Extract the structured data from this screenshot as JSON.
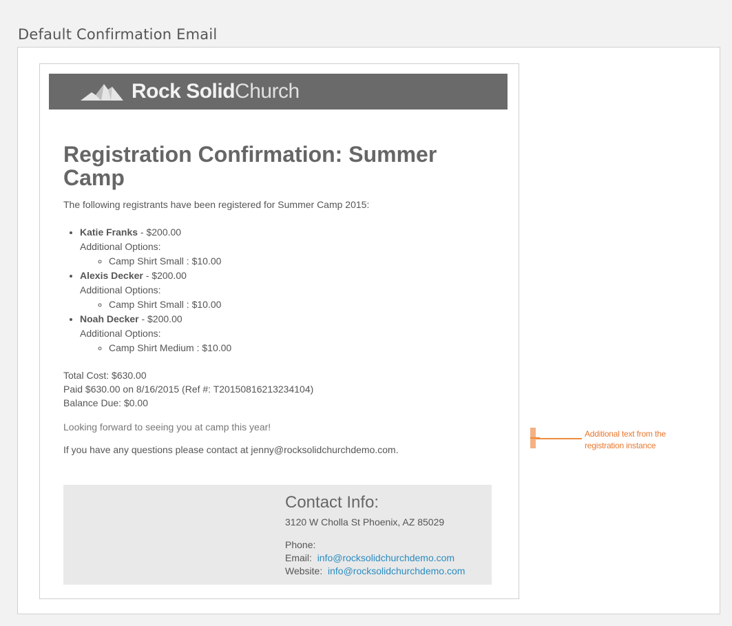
{
  "caption": "Default Confirmation Email",
  "brand": {
    "name_bold": "Rock Solid",
    "name_light": "Church",
    "logo_icon": "mountain-logo-icon"
  },
  "email": {
    "title": "Registration Confirmation: Summer Camp",
    "intro": "The following registrants have been registered for Summer Camp 2015:",
    "registrants": [
      {
        "name": "Katie Franks",
        "price": " - $200.00",
        "options_label": "Additional Options:",
        "option": "Camp Shirt Small : $10.00"
      },
      {
        "name": "Alexis Decker",
        "price": " - $200.00",
        "options_label": "Additional Options:",
        "option": "Camp Shirt Small : $10.00"
      },
      {
        "name": "Noah Decker",
        "price": " - $200.00",
        "options_label": "Additional Options:",
        "option": "Camp Shirt Medium : $10.00"
      }
    ],
    "total_cost": "Total Cost: $630.00",
    "paid": "Paid $630.00 on 8/16/2015 (Ref #: T20150816213234104)",
    "balance": "Balance Due: $0.00",
    "additional_text": "Looking forward to seeing you at camp this year!",
    "contact_line": "If you have any questions please contact at jenny@rocksolidchurchdemo.com."
  },
  "contact": {
    "title": "Contact Info:",
    "address": "3120 W Cholla St Phoenix, AZ 85029",
    "phone_label": "Phone:",
    "email_label": "Email:",
    "email_value": "info@rocksolidchurchdemo.com",
    "website_label": "Website:",
    "website_value": "info@rocksolidchurchdemo.com"
  },
  "annotation": {
    "text": "Additional text from the registration instance",
    "color": "#e8772e"
  },
  "colors": {
    "banner": "#6a6a6a",
    "link": "#2a8bbf",
    "contact_bg": "#e9e9e9"
  }
}
